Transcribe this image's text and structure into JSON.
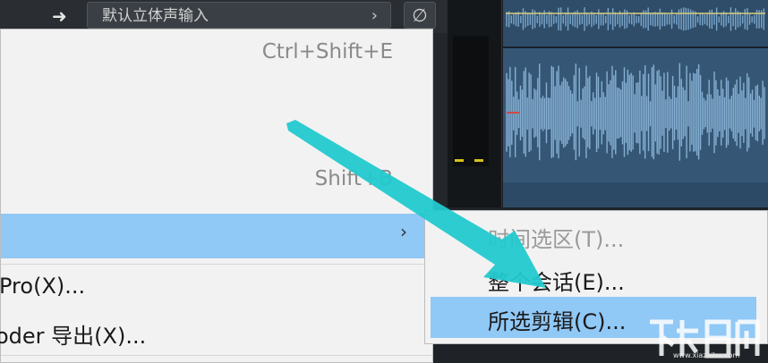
{
  "track": {
    "arrow_icon": "arrow-right-icon",
    "input_name": "默认立体声输入",
    "input_chevron": "›",
    "null_symbol": "∅"
  },
  "menu": {
    "item1": {
      "label": "",
      "shortcut": "Ctrl+Shift+E"
    },
    "item2": {
      "label": "",
      "shortcut": "Shift+B"
    },
    "highlighted_item": {
      "label": "",
      "chevron": "›"
    },
    "item_pro": {
      "label": "Pro(X)..."
    },
    "item_coder": {
      "label": "oder 导出(X)..."
    }
  },
  "submenu": {
    "items": [
      {
        "label": "时间选区(T)...",
        "enabled": false
      },
      {
        "label": "整个会话(E)...",
        "enabled": true
      },
      {
        "label": "所选剪辑(C)...",
        "enabled": true,
        "highlighted": true
      }
    ]
  },
  "colors": {
    "highlight": "#90c8f6",
    "annotation_arrow": "#22c9cf",
    "waveform": "#6f9cc2"
  },
  "watermark": {
    "site": "www.xiazaiba.com"
  }
}
